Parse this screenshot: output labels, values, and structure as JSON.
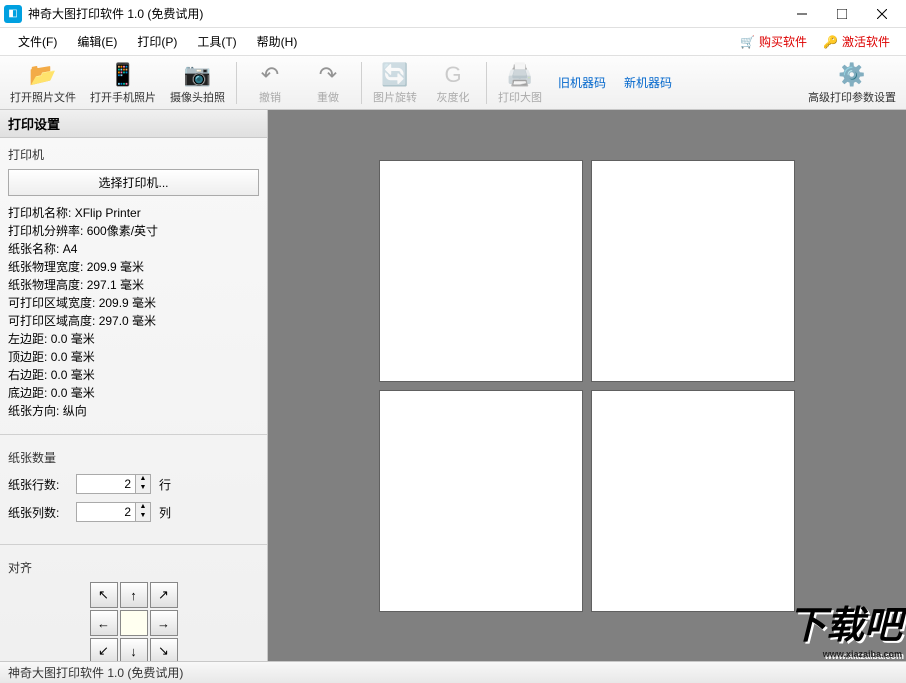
{
  "window": {
    "title": "神奇大图打印软件 1.0 (免费试用)"
  },
  "menubar": {
    "file": "文件(F)",
    "edit": "编辑(E)",
    "print": "打印(P)",
    "tools": "工具(T)",
    "help": "帮助(H)",
    "buy": "购买软件",
    "activate": "激活软件"
  },
  "toolbar": {
    "open_photo": "打开照片文件",
    "open_phone": "打开手机照片",
    "camera": "摄像头拍照",
    "undo": "撤销",
    "redo": "重做",
    "rotate": "图片旋转",
    "grayscale": "灰度化",
    "print_big": "打印大图",
    "old_code": "旧机器码",
    "new_code": "新机器码",
    "adv_settings": "高级打印参数设置"
  },
  "sidebar": {
    "header": "打印设置",
    "printer_section": "打印机",
    "select_printer": "选择打印机...",
    "info": {
      "name_label": "打印机名称:",
      "name_value": "XFlip Printer",
      "res_label": "打印机分辨率:",
      "res_value": "600像素/英寸",
      "paper_label": "纸张名称:",
      "paper_value": "A4",
      "pw_label": "纸张物理宽度:",
      "pw_value": "209.9 毫米",
      "ph_label": "纸张物理高度:",
      "ph_value": "297.1 毫米",
      "aw_label": "可打印区域宽度:",
      "aw_value": "209.9 毫米",
      "ah_label": "可打印区域高度:",
      "ah_value": "297.0 毫米",
      "ml_label": "左边距:",
      "ml_value": "0.0 毫米",
      "mt_label": "顶边距:",
      "mt_value": "0.0 毫米",
      "mr_label": "右边距:",
      "mr_value": "0.0 毫米",
      "mb_label": "底边距:",
      "mb_value": "0.0 毫米",
      "orient_label": "纸张方向:",
      "orient_value": "纵向"
    },
    "paper_count_section": "纸张数量",
    "rows_label": "纸张行数:",
    "rows_value": "2",
    "rows_unit": "行",
    "cols_label": "纸张列数:",
    "cols_value": "2",
    "cols_unit": "列",
    "align_section": "对齐"
  },
  "statusbar": {
    "text": "神奇大图打印软件 1.0 (免费试用)"
  },
  "watermark": {
    "text": "下载吧",
    "url": "www.xiazaiba.com"
  }
}
